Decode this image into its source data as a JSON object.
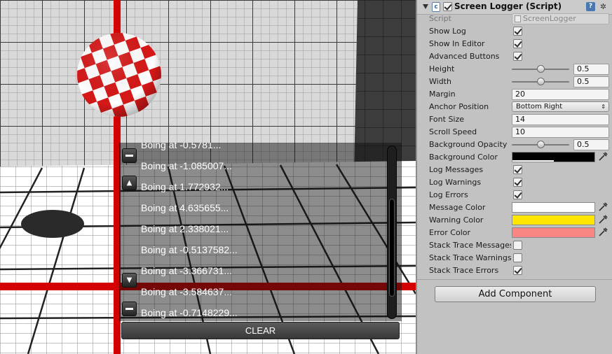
{
  "logger": {
    "partial_message": "Boing at -0.5781...",
    "messages": [
      "Boing at -1.085007...",
      "Boing at 1.772932...",
      "Boing at 4.635655...",
      "Boing at 2.338021...",
      "Boing at -0.5137582...",
      "Boing at -3.366731...",
      "Boing at -3.584637...",
      "Boing at -0.7148229..."
    ],
    "up_arrow": "▲",
    "down_arrow": "▼",
    "clear_label": "CLEAR",
    "scroll_position": 0.72
  },
  "inspector": {
    "component_title": "Screen Logger (Script)",
    "script": {
      "label": "Script",
      "value": "ScreenLogger"
    },
    "show_log": {
      "label": "Show Log",
      "checked": true
    },
    "show_in_editor": {
      "label": "Show In Editor",
      "checked": true
    },
    "advanced_buttons": {
      "label": "Advanced Buttons",
      "checked": true
    },
    "height": {
      "label": "Height",
      "value": "0.5",
      "slider": 0.5
    },
    "width": {
      "label": "Width",
      "value": "0.5",
      "slider": 0.5
    },
    "margin": {
      "label": "Margin",
      "value": "20"
    },
    "anchor_position": {
      "label": "Anchor Position",
      "value": "Bottom Right"
    },
    "font_size": {
      "label": "Font Size",
      "value": "14"
    },
    "scroll_speed": {
      "label": "Scroll Speed",
      "value": "10"
    },
    "background_opacity": {
      "label": "Background Opacity",
      "value": "0.5",
      "slider": 0.5
    },
    "background_color": {
      "label": "Background Color",
      "color": "#000000",
      "alpha": 0.5
    },
    "log_messages": {
      "label": "Log Messages",
      "checked": true
    },
    "log_warnings": {
      "label": "Log Warnings",
      "checked": true
    },
    "log_errors": {
      "label": "Log Errors",
      "checked": true
    },
    "message_color": {
      "label": "Message Color",
      "color": "#ffffff"
    },
    "warning_color": {
      "label": "Warning Color",
      "color": "#ffe600"
    },
    "error_color": {
      "label": "Error Color",
      "color": "#f98585"
    },
    "stack_trace_messages": {
      "label": "Stack Trace Messages",
      "checked": false
    },
    "stack_trace_warnings": {
      "label": "Stack Trace Warnings",
      "checked": false
    },
    "stack_trace_errors": {
      "label": "Stack Trace Errors",
      "checked": true
    },
    "add_component_label": "Add Component"
  }
}
